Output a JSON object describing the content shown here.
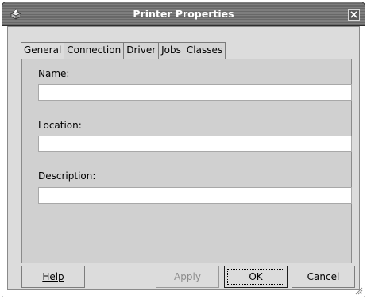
{
  "window": {
    "title": "Printer Properties",
    "app_icon": "printer-icon",
    "close_icon": "close-icon"
  },
  "tabs": [
    {
      "label": "General",
      "active": true
    },
    {
      "label": "Connection",
      "active": false
    },
    {
      "label": "Driver",
      "active": false
    },
    {
      "label": "Jobs",
      "active": false
    },
    {
      "label": "Classes",
      "active": false
    }
  ],
  "general": {
    "name_label": "Name:",
    "name_value": "",
    "location_label": "Location:",
    "location_value": "",
    "description_label": "Description:",
    "description_value": ""
  },
  "buttons": {
    "help": "Help",
    "apply": "Apply",
    "ok": "OK",
    "cancel": "Cancel"
  },
  "colors": {
    "titlebar": "#6f6f6f",
    "dialog_bg": "#dcdcdc",
    "field_bg": "#ffffff"
  }
}
